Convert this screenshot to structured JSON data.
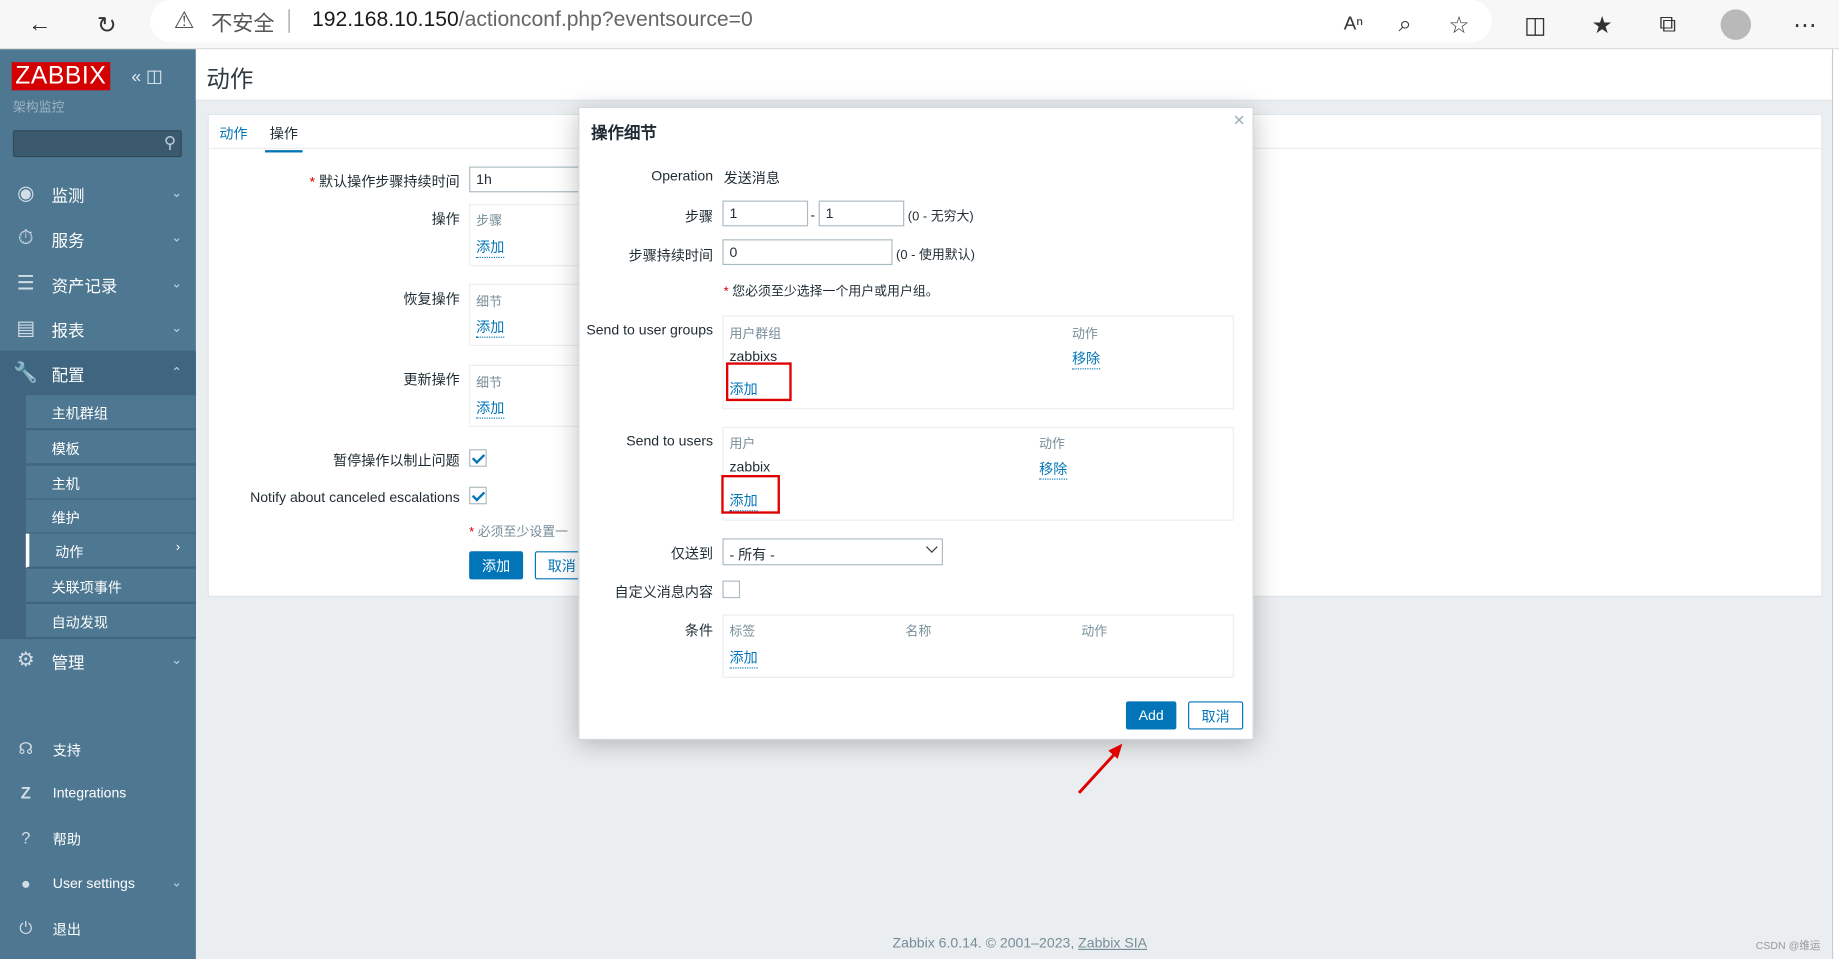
{
  "browser": {
    "insecure_label": "不安全",
    "url_host": "192.168.10.150",
    "url_path": "/actionconf.php?eventsource=0"
  },
  "sidebar": {
    "logo": "ZABBIX",
    "subtitle": "架构监控",
    "menu": [
      {
        "label": "监测"
      },
      {
        "label": "服务"
      },
      {
        "label": "资产记录"
      },
      {
        "label": "报表"
      },
      {
        "label": "配置"
      },
      {
        "label": "管理"
      }
    ],
    "config_items": [
      "主机群组",
      "模板",
      "主机",
      "维护",
      "动作",
      "关联项事件",
      "自动发现"
    ],
    "bottom": [
      {
        "label": "支持"
      },
      {
        "label": "Integrations"
      },
      {
        "label": "帮助"
      },
      {
        "label": "User settings"
      },
      {
        "label": "退出"
      }
    ]
  },
  "page": {
    "title": "动作",
    "tabs": [
      "动作",
      "操作"
    ],
    "form": {
      "default_duration_label": "默认操作步骤持续时间",
      "default_duration_value": "1h",
      "ops_label": "操作",
      "ops_header": "步骤",
      "recovery_label": "恢复操作",
      "recovery_header": "细节",
      "update_label": "更新操作",
      "update_header": "细节",
      "add_link": "添加",
      "pause_label": "暂停操作以制止问题",
      "notify_label": "Notify about canceled escalations",
      "must_note": "必须至少设置一",
      "add_button": "添加",
      "cancel_button": "取消"
    }
  },
  "modal": {
    "title": "操作细节",
    "operation_label": "Operation",
    "operation_value": "发送消息",
    "steps_label": "步骤",
    "step_from": "1",
    "step_to": "1",
    "step_dash": "-",
    "steps_hint": "(0 - 无穷大)",
    "duration_label": "步骤持续时间",
    "duration_value": "0",
    "duration_hint": "(0 - 使用默认)",
    "must_select": "您必须至少选择一个用户或用户组。",
    "groups_label": "Send to user groups",
    "groups_col1": "用户群组",
    "groups_col2": "动作",
    "group_name": "zabbixs",
    "group_remove": "移除",
    "groups_add": "添加",
    "users_label": "Send to users",
    "users_col1": "用户",
    "users_col2": "动作",
    "user_name": "zabbix",
    "user_remove": "移除",
    "users_add": "添加",
    "sendonly_label": "仅送到",
    "sendonly_value": "- 所有 -",
    "custom_msg_label": "自定义消息内容",
    "cond_label": "条件",
    "cond_col1": "标签",
    "cond_col2": "名称",
    "cond_col3": "动作",
    "cond_add": "添加",
    "add_button": "Add",
    "cancel_button": "取消"
  },
  "footer": {
    "text": "Zabbix 6.0.14. © 2001–2023, ",
    "company": "Zabbix SIA",
    "watermark": "CSDN @维运"
  },
  "colors": {
    "sidebar": "#4e7792",
    "accent": "#0275b8",
    "logo": "#d40000",
    "highlight": "#e00000"
  }
}
